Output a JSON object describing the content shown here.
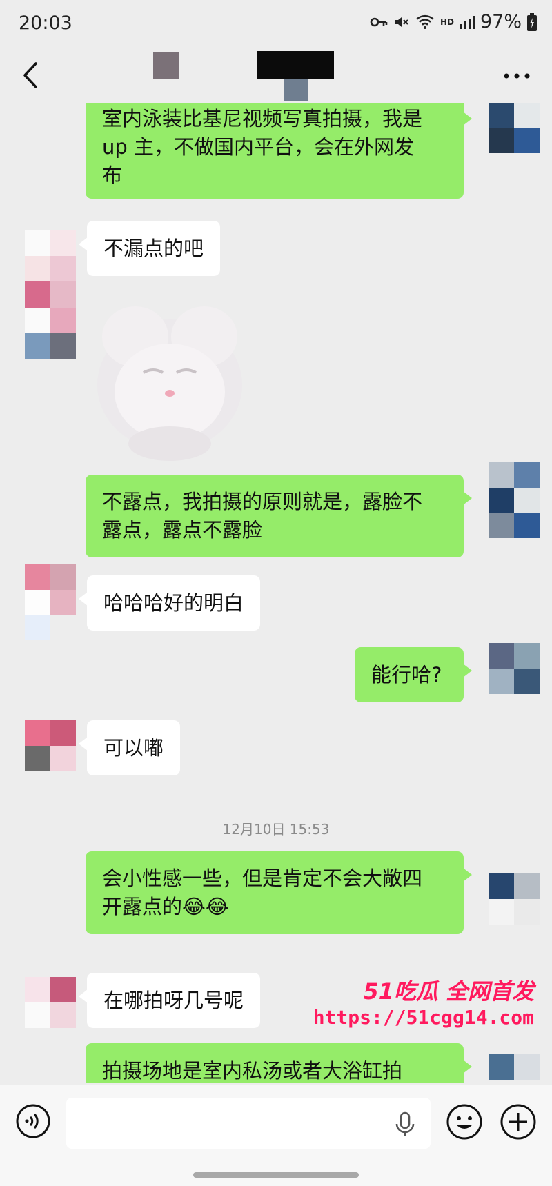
{
  "status_bar": {
    "time": "20:03",
    "battery": "97%",
    "network": "HD"
  },
  "chat_header": {
    "more_label": "···"
  },
  "messages": [
    {
      "side": "me",
      "text_lines": [
        "室内泳装比基尼视频写真拍摄，我是",
        "up 主，不做国内平台，会在外网发",
        "布"
      ]
    },
    {
      "side": "them",
      "text": "不漏点的吧"
    },
    {
      "side": "me",
      "text_lines": [
        "不露点，我拍摄的原则就是，露脸不",
        "露点，露点不露脸"
      ]
    },
    {
      "side": "them",
      "text": "哈哈哈好的明白"
    },
    {
      "side": "me",
      "text": "能行哈?"
    },
    {
      "side": "them",
      "text": "可以嘟"
    },
    {
      "timestamp": "12月10日 15:53"
    },
    {
      "side": "me",
      "text_lines": [
        "会小性感一些，但是肯定不会大敞四",
        "开露点的😂😂"
      ]
    },
    {
      "side": "them",
      "text": "在哪拍呀几号呢"
    },
    {
      "side": "me",
      "text": "拍摄场地是室内私汤或者大浴缸拍"
    }
  ],
  "watermark": {
    "brand": "51吃瓜 全网首发",
    "url": "https://51cgg14.com"
  },
  "colors": {
    "my_bubble": "#95ec69",
    "their_bubble": "#ffffff",
    "background": "#ededed",
    "watermark": "#ff1a5e"
  }
}
